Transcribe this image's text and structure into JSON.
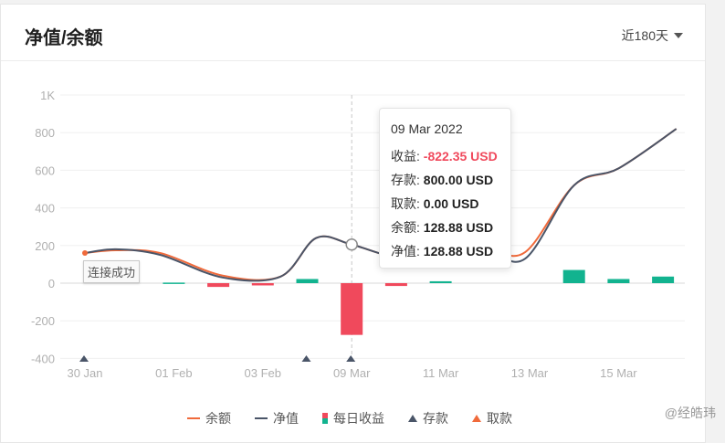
{
  "header": {
    "title": "净值/余额",
    "range_label": "近180天"
  },
  "toast": "连接成功",
  "watermark": "@经皓玮",
  "tooltip": {
    "date": "09 Mar 2022",
    "rows": [
      {
        "label": "收益:",
        "value": "-822.35 USD"
      },
      {
        "label": "存款:",
        "value": "800.00 USD"
      },
      {
        "label": "取款:",
        "value": "0.00 USD"
      },
      {
        "label": "余额:",
        "value": "128.88 USD"
      },
      {
        "label": "净值:",
        "value": "128.88 USD"
      }
    ]
  },
  "legend": {
    "balance": "余额",
    "equity": "净值",
    "daily": "每日收益",
    "deposit": "存款",
    "withdraw": "取款"
  },
  "colors": {
    "balance": "#f06a3b",
    "equity": "#4a5568",
    "positive": "#12b38f",
    "negative": "#f0495c"
  },
  "chart_data": {
    "type": "line",
    "ylim": [
      -400,
      1000
    ],
    "y_ticks": [
      -400,
      -200,
      0,
      200,
      400,
      600,
      800,
      1000
    ],
    "y_tick_labels": [
      "-400",
      "-200",
      "0",
      "200",
      "400",
      "600",
      "800",
      "1K"
    ],
    "x_ticks": [
      {
        "day": 0,
        "label": "30 Jan"
      },
      {
        "day": 2,
        "label": "01 Feb"
      },
      {
        "day": 4,
        "label": "03 Feb"
      },
      {
        "day": 6,
        "label": "09 Mar"
      },
      {
        "day": 8,
        "label": "11 Mar"
      },
      {
        "day": 10,
        "label": "13 Mar"
      },
      {
        "day": 12,
        "label": "15 Mar"
      }
    ],
    "series": [
      {
        "name": "净值",
        "x": [
          0,
          0.7,
          1.7,
          3.1,
          4.4,
          5.2,
          6,
          7,
          8,
          9,
          9.9,
          11,
          12,
          13.3
        ],
        "values": [
          160,
          180,
          150,
          30,
          35,
          240,
          205,
          140,
          165,
          180,
          130,
          520,
          610,
          820
        ]
      },
      {
        "name": "余额",
        "x": [
          0,
          0.7,
          1.7,
          3.1,
          4.4,
          5.2,
          6,
          7,
          8,
          9,
          9.9,
          11,
          12,
          13.3
        ],
        "values": [
          160,
          175,
          160,
          40,
          35,
          240,
          205,
          140,
          165,
          185,
          165,
          520,
          610,
          820
        ]
      }
    ],
    "daily_profit": [
      {
        "day": 2,
        "value": 3
      },
      {
        "day": 3,
        "value": -20
      },
      {
        "day": 4,
        "value": -12
      },
      {
        "day": 5,
        "value": 22
      },
      {
        "day": 6,
        "value": -275
      },
      {
        "day": 7,
        "value": -15
      },
      {
        "day": 8,
        "value": 10
      },
      {
        "day": 11,
        "value": 70
      },
      {
        "day": 12,
        "value": 22
      },
      {
        "day": 13,
        "value": 35
      }
    ],
    "deposits": [
      0,
      5,
      6
    ],
    "withdrawals": [
      0
    ],
    "crosshair_day": 6
  }
}
